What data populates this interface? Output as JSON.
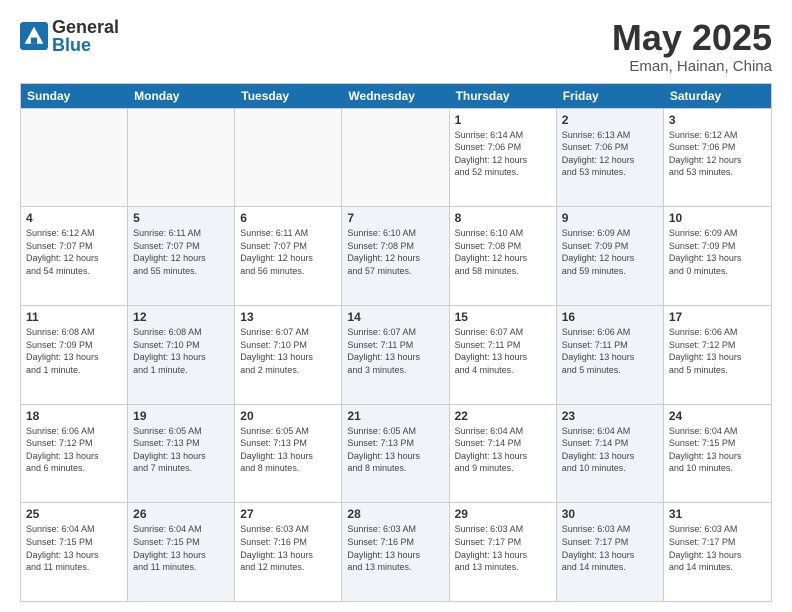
{
  "header": {
    "logo_general": "General",
    "logo_blue": "Blue",
    "month_title": "May 2025",
    "location": "Eman, Hainan, China"
  },
  "weekdays": [
    "Sunday",
    "Monday",
    "Tuesday",
    "Wednesday",
    "Thursday",
    "Friday",
    "Saturday"
  ],
  "weeks": [
    [
      {
        "day": "",
        "info": "",
        "shaded": false,
        "empty": true
      },
      {
        "day": "",
        "info": "",
        "shaded": false,
        "empty": true
      },
      {
        "day": "",
        "info": "",
        "shaded": false,
        "empty": true
      },
      {
        "day": "",
        "info": "",
        "shaded": false,
        "empty": true
      },
      {
        "day": "1",
        "info": "Sunrise: 6:14 AM\nSunset: 7:06 PM\nDaylight: 12 hours\nand 52 minutes.",
        "shaded": false,
        "empty": false
      },
      {
        "day": "2",
        "info": "Sunrise: 6:13 AM\nSunset: 7:06 PM\nDaylight: 12 hours\nand 53 minutes.",
        "shaded": true,
        "empty": false
      },
      {
        "day": "3",
        "info": "Sunrise: 6:12 AM\nSunset: 7:06 PM\nDaylight: 12 hours\nand 53 minutes.",
        "shaded": false,
        "empty": false
      }
    ],
    [
      {
        "day": "4",
        "info": "Sunrise: 6:12 AM\nSunset: 7:07 PM\nDaylight: 12 hours\nand 54 minutes.",
        "shaded": false,
        "empty": false
      },
      {
        "day": "5",
        "info": "Sunrise: 6:11 AM\nSunset: 7:07 PM\nDaylight: 12 hours\nand 55 minutes.",
        "shaded": true,
        "empty": false
      },
      {
        "day": "6",
        "info": "Sunrise: 6:11 AM\nSunset: 7:07 PM\nDaylight: 12 hours\nand 56 minutes.",
        "shaded": false,
        "empty": false
      },
      {
        "day": "7",
        "info": "Sunrise: 6:10 AM\nSunset: 7:08 PM\nDaylight: 12 hours\nand 57 minutes.",
        "shaded": true,
        "empty": false
      },
      {
        "day": "8",
        "info": "Sunrise: 6:10 AM\nSunset: 7:08 PM\nDaylight: 12 hours\nand 58 minutes.",
        "shaded": false,
        "empty": false
      },
      {
        "day": "9",
        "info": "Sunrise: 6:09 AM\nSunset: 7:09 PM\nDaylight: 12 hours\nand 59 minutes.",
        "shaded": true,
        "empty": false
      },
      {
        "day": "10",
        "info": "Sunrise: 6:09 AM\nSunset: 7:09 PM\nDaylight: 13 hours\nand 0 minutes.",
        "shaded": false,
        "empty": false
      }
    ],
    [
      {
        "day": "11",
        "info": "Sunrise: 6:08 AM\nSunset: 7:09 PM\nDaylight: 13 hours\nand 1 minute.",
        "shaded": false,
        "empty": false
      },
      {
        "day": "12",
        "info": "Sunrise: 6:08 AM\nSunset: 7:10 PM\nDaylight: 13 hours\nand 1 minute.",
        "shaded": true,
        "empty": false
      },
      {
        "day": "13",
        "info": "Sunrise: 6:07 AM\nSunset: 7:10 PM\nDaylight: 13 hours\nand 2 minutes.",
        "shaded": false,
        "empty": false
      },
      {
        "day": "14",
        "info": "Sunrise: 6:07 AM\nSunset: 7:11 PM\nDaylight: 13 hours\nand 3 minutes.",
        "shaded": true,
        "empty": false
      },
      {
        "day": "15",
        "info": "Sunrise: 6:07 AM\nSunset: 7:11 PM\nDaylight: 13 hours\nand 4 minutes.",
        "shaded": false,
        "empty": false
      },
      {
        "day": "16",
        "info": "Sunrise: 6:06 AM\nSunset: 7:11 PM\nDaylight: 13 hours\nand 5 minutes.",
        "shaded": true,
        "empty": false
      },
      {
        "day": "17",
        "info": "Sunrise: 6:06 AM\nSunset: 7:12 PM\nDaylight: 13 hours\nand 5 minutes.",
        "shaded": false,
        "empty": false
      }
    ],
    [
      {
        "day": "18",
        "info": "Sunrise: 6:06 AM\nSunset: 7:12 PM\nDaylight: 13 hours\nand 6 minutes.",
        "shaded": false,
        "empty": false
      },
      {
        "day": "19",
        "info": "Sunrise: 6:05 AM\nSunset: 7:13 PM\nDaylight: 13 hours\nand 7 minutes.",
        "shaded": true,
        "empty": false
      },
      {
        "day": "20",
        "info": "Sunrise: 6:05 AM\nSunset: 7:13 PM\nDaylight: 13 hours\nand 8 minutes.",
        "shaded": false,
        "empty": false
      },
      {
        "day": "21",
        "info": "Sunrise: 6:05 AM\nSunset: 7:13 PM\nDaylight: 13 hours\nand 8 minutes.",
        "shaded": true,
        "empty": false
      },
      {
        "day": "22",
        "info": "Sunrise: 6:04 AM\nSunset: 7:14 PM\nDaylight: 13 hours\nand 9 minutes.",
        "shaded": false,
        "empty": false
      },
      {
        "day": "23",
        "info": "Sunrise: 6:04 AM\nSunset: 7:14 PM\nDaylight: 13 hours\nand 10 minutes.",
        "shaded": true,
        "empty": false
      },
      {
        "day": "24",
        "info": "Sunrise: 6:04 AM\nSunset: 7:15 PM\nDaylight: 13 hours\nand 10 minutes.",
        "shaded": false,
        "empty": false
      }
    ],
    [
      {
        "day": "25",
        "info": "Sunrise: 6:04 AM\nSunset: 7:15 PM\nDaylight: 13 hours\nand 11 minutes.",
        "shaded": false,
        "empty": false
      },
      {
        "day": "26",
        "info": "Sunrise: 6:04 AM\nSunset: 7:15 PM\nDaylight: 13 hours\nand 11 minutes.",
        "shaded": true,
        "empty": false
      },
      {
        "day": "27",
        "info": "Sunrise: 6:03 AM\nSunset: 7:16 PM\nDaylight: 13 hours\nand 12 minutes.",
        "shaded": false,
        "empty": false
      },
      {
        "day": "28",
        "info": "Sunrise: 6:03 AM\nSunset: 7:16 PM\nDaylight: 13 hours\nand 13 minutes.",
        "shaded": true,
        "empty": false
      },
      {
        "day": "29",
        "info": "Sunrise: 6:03 AM\nSunset: 7:17 PM\nDaylight: 13 hours\nand 13 minutes.",
        "shaded": false,
        "empty": false
      },
      {
        "day": "30",
        "info": "Sunrise: 6:03 AM\nSunset: 7:17 PM\nDaylight: 13 hours\nand 14 minutes.",
        "shaded": true,
        "empty": false
      },
      {
        "day": "31",
        "info": "Sunrise: 6:03 AM\nSunset: 7:17 PM\nDaylight: 13 hours\nand 14 minutes.",
        "shaded": false,
        "empty": false
      }
    ]
  ]
}
